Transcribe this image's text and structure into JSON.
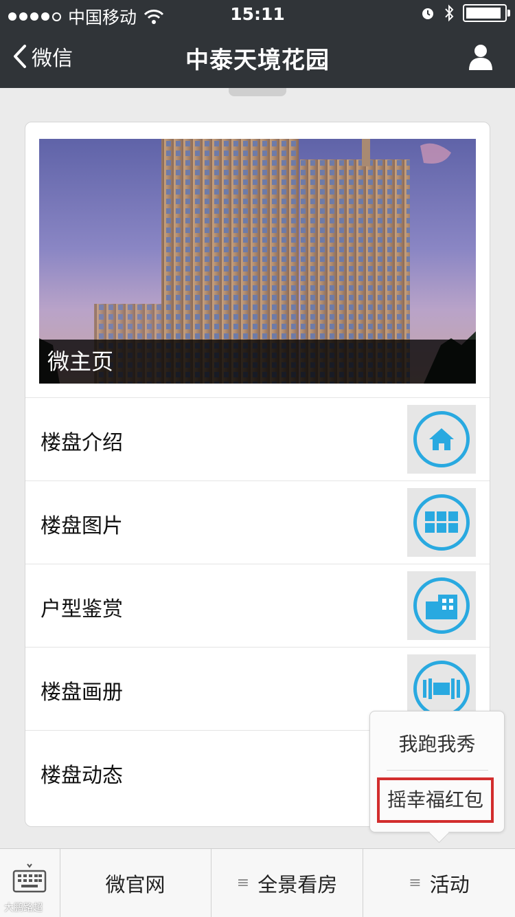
{
  "status_bar": {
    "carrier": "中国移动",
    "time": "15:11",
    "battery_level": 0.92
  },
  "nav": {
    "back_label": "微信",
    "title": "中泰天境花园"
  },
  "hero": {
    "caption": "微主页"
  },
  "menu": {
    "items": [
      {
        "label": "楼盘介绍",
        "icon": "house-icon"
      },
      {
        "label": "楼盘图片",
        "icon": "grid-icon"
      },
      {
        "label": "户型鉴赏",
        "icon": "building-icon"
      },
      {
        "label": "楼盘画册",
        "icon": "album-icon"
      },
      {
        "label": "楼盘动态",
        "icon": "news-icon"
      }
    ]
  },
  "popup": {
    "items": [
      "我跑我秀",
      "摇幸福红包"
    ]
  },
  "bottom_bar": {
    "tabs": [
      "微官网",
      "全景看房",
      "活动"
    ]
  },
  "watermark": "大鹏路超",
  "colors": {
    "nav_bg": "#303438",
    "icon_accent": "#29a9e0",
    "highlight_border": "#d22d2d"
  }
}
